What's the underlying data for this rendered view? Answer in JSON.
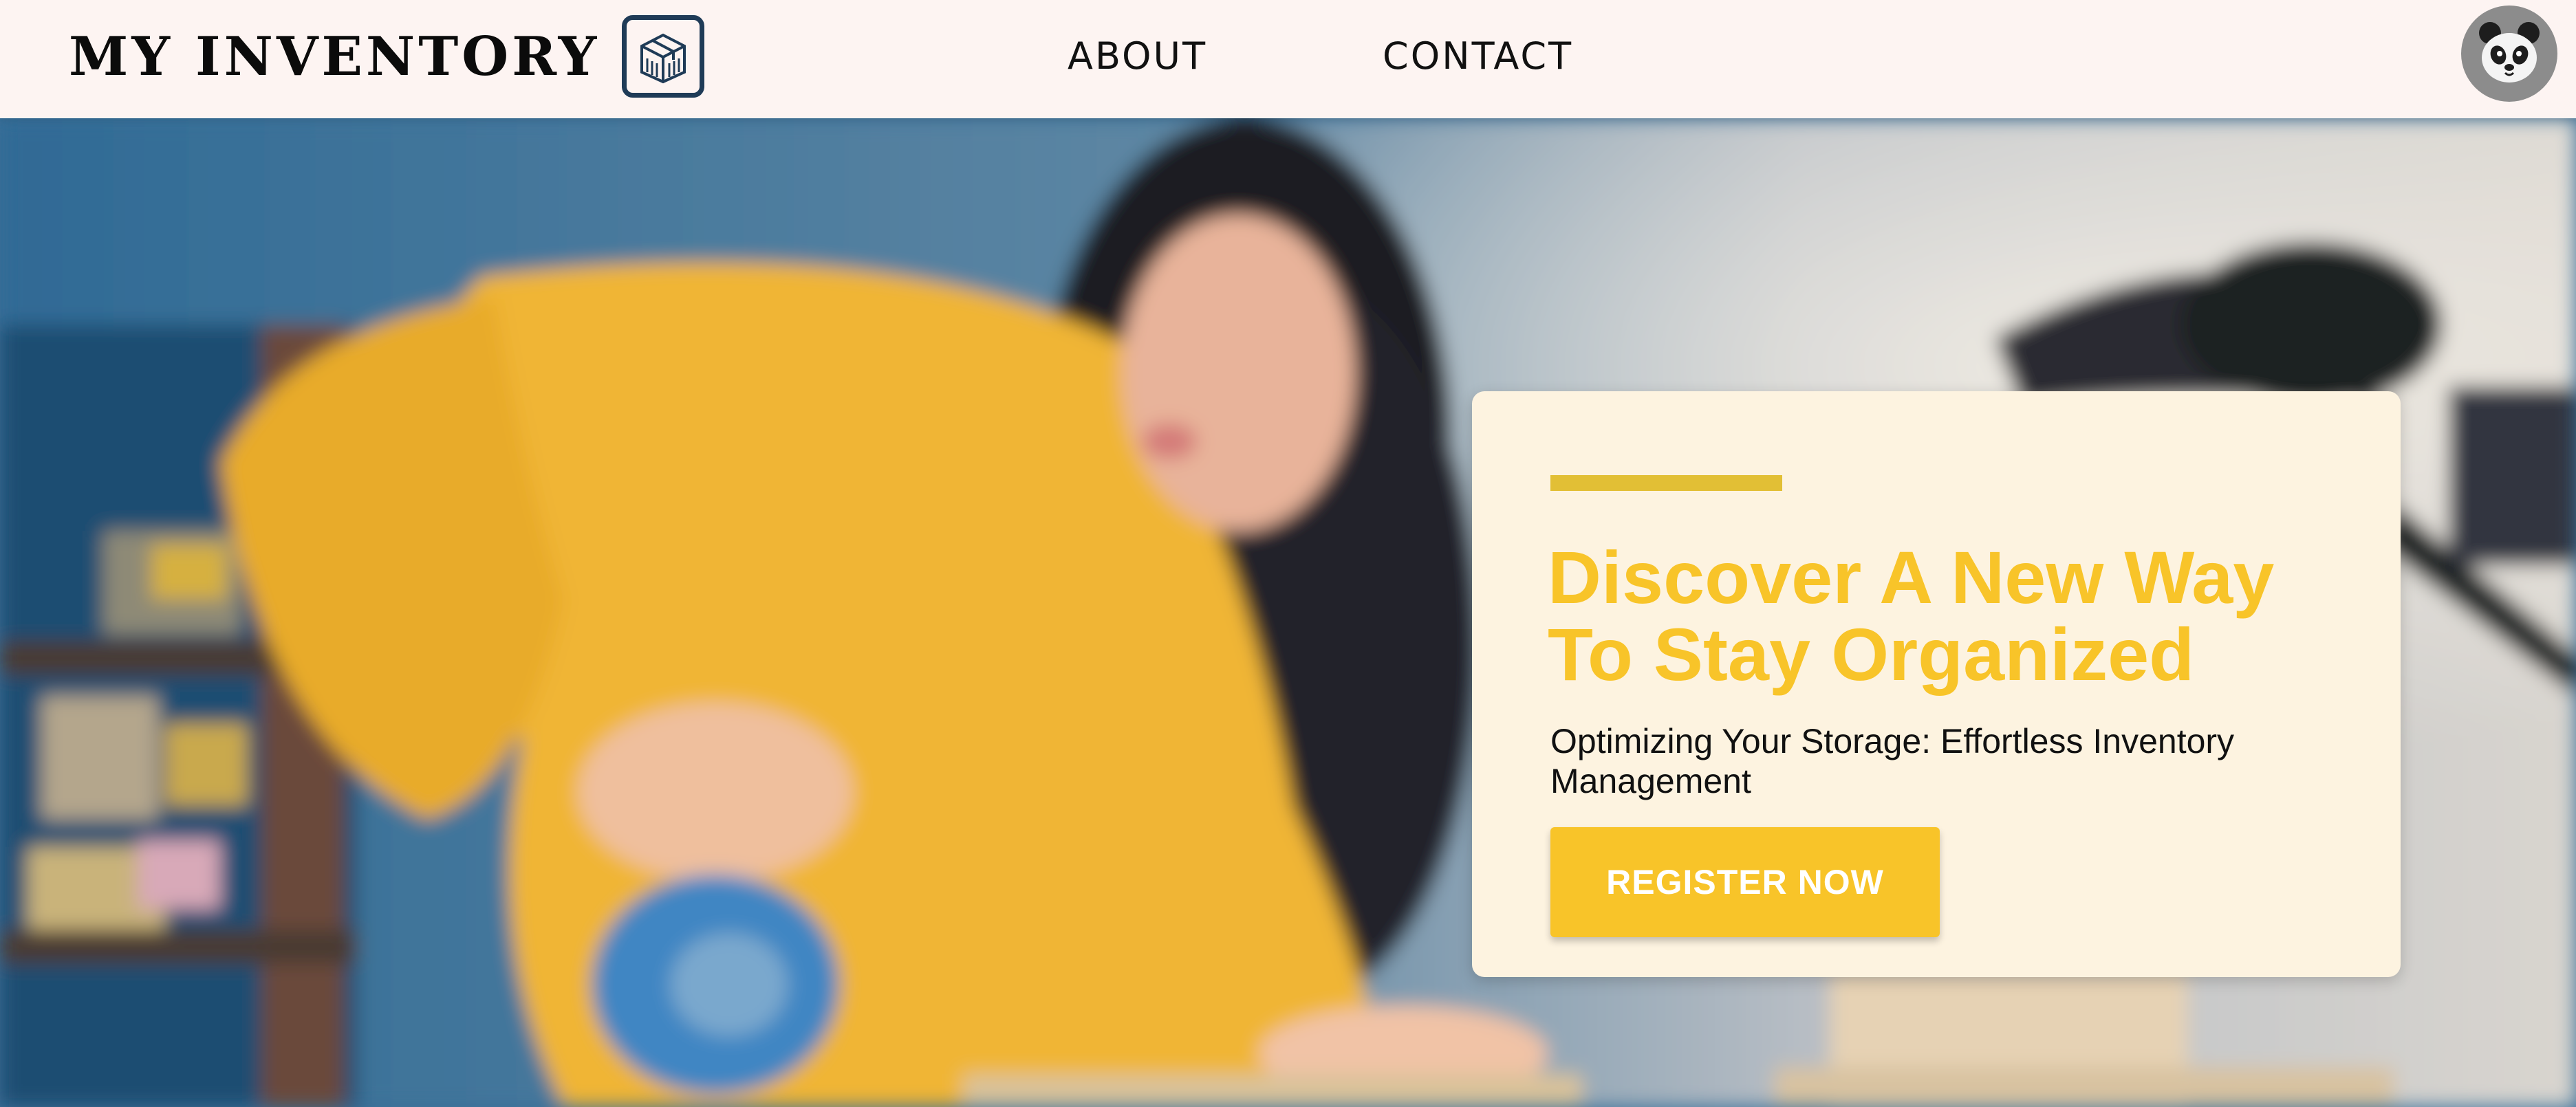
{
  "header": {
    "brand": "MY INVENTORY",
    "brand_icon": "inventory-box-icon",
    "nav": {
      "about_label": "ABOUT",
      "contact_label": "CONTACT"
    },
    "avatar_icon": "panda-avatar-icon"
  },
  "hero": {
    "image": "blurred photo of a woman in a yellow sweater taping a cardboard box in a storage room",
    "card": {
      "headline": "Discover A New Way To Stay Organized",
      "subheadline": "Optimizing Your Storage: Effortless Inventory Management",
      "cta_label": "REGISTER NOW"
    }
  },
  "colors": {
    "accent": "#f8c429",
    "accent_bar": "#e2bf35",
    "navbar_bg": "#fdf4f2",
    "card_bg": "#fdf3e0",
    "logo_border": "#1f3b57"
  }
}
